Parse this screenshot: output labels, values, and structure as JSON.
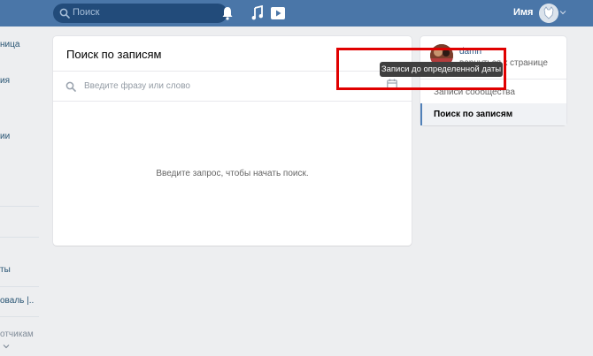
{
  "header": {
    "search_placeholder": "Поиск",
    "user_name": "Имя",
    "icons": [
      "search-icon",
      "bell-icon",
      "music-icon",
      "play-icon",
      "chevron-down-icon"
    ]
  },
  "sidebar": {
    "items": [
      "ница",
      "ия",
      "ии",
      "ты",
      "оваль |..",
      "отчикам"
    ]
  },
  "main": {
    "title": "Поиск по записям",
    "search_placeholder": "Введите фразу или слово",
    "empty_message": "Введите запрос, чтобы начать поиск."
  },
  "tooltip": {
    "text": "Записи до определенной даты"
  },
  "right_panel": {
    "community_name": "damn",
    "community_sub": "вернуться к странице",
    "items": [
      {
        "label": "Записи сообщества",
        "active": false
      },
      {
        "label": "Поиск по записям",
        "active": true
      }
    ]
  },
  "colors": {
    "header_bg": "#4a76a8",
    "page_bg": "#edeef0",
    "highlight": "#e00000",
    "link": "#2a5885"
  }
}
